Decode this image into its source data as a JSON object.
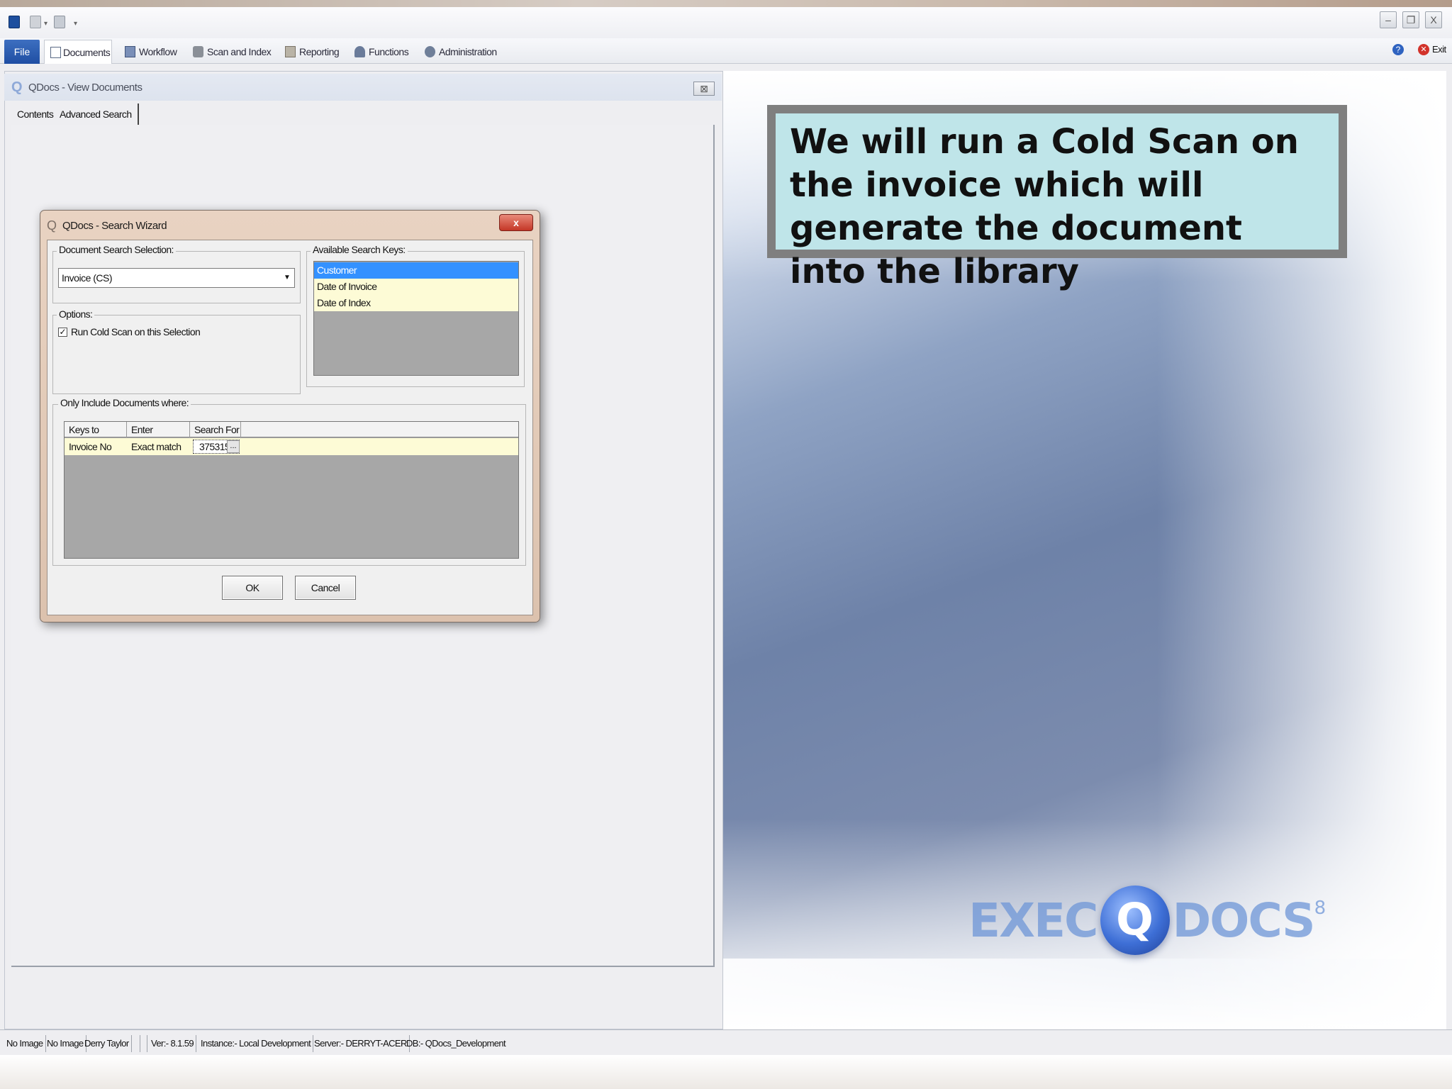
{
  "window": {
    "qat_sep": "▾",
    "controls": {
      "minimize": "–",
      "restore": "❐",
      "close": "X"
    }
  },
  "ribbon": {
    "file_label": "File",
    "tabs": [
      {
        "label": "Documents",
        "icon": "document-icon"
      },
      {
        "label": "Workflow",
        "icon": "workflow-icon"
      },
      {
        "label": "Scan and Index",
        "icon": "scanner-icon"
      },
      {
        "label": "Reporting",
        "icon": "printer-icon"
      },
      {
        "label": "Functions",
        "icon": "functions-icon"
      },
      {
        "label": "Administration",
        "icon": "gear-icon"
      }
    ],
    "help_glyph": "?",
    "exit_label": "Exit"
  },
  "doc_window": {
    "title": "QDocs - View Documents",
    "close_glyph": "⊠",
    "tabs": [
      "Contents",
      "Advanced Search"
    ]
  },
  "wizard": {
    "title": "QDocs - Search Wizard",
    "close_glyph": "x",
    "doc_selection_label": "Document Search Selection:",
    "doc_selection_value": "Invoice (CS)",
    "dropdown_glyph": "▼",
    "options_label": "Options:",
    "cold_scan_label": "Run Cold Scan on this Selection",
    "cold_scan_checked": true,
    "check_glyph": "✓",
    "available_keys_label": "Available Search Keys:",
    "available_keys": [
      "Customer",
      "Date of Invoice",
      "Date of Index"
    ],
    "selected_key": "Customer",
    "where_label": "Only Include Documents where:",
    "grid_columns": [
      "Keys to Search",
      "Enter Condition",
      "Search For"
    ],
    "grid_rows": [
      {
        "key": "Invoice No",
        "condition": "Exact match",
        "search_for": "375315"
      }
    ],
    "ellipsis": "...",
    "ok_label": "OK",
    "cancel_label": "Cancel"
  },
  "caption": {
    "text": "We will run a Cold Scan on the invoice which will generate the document into the library"
  },
  "logo": {
    "left": "EXEC",
    "q": "Q",
    "right": "DOCS",
    "sup": "8"
  },
  "status_bar": [
    "No Image",
    "No Image",
    "Derry Taylor",
    "",
    "",
    "Ver:- 8.1.59",
    "Instance:- Local Development",
    "Server:- DERRYT-ACER",
    "DB:- QDocs_Development"
  ],
  "colors": {
    "selection": "#3391ff",
    "grid_row": "#fdfbd6",
    "caption_bg": "#bfe5e9",
    "caption_border": "#7f7f7f",
    "wizard_close": "#c43626",
    "file_tab": "#1f4ea3"
  }
}
